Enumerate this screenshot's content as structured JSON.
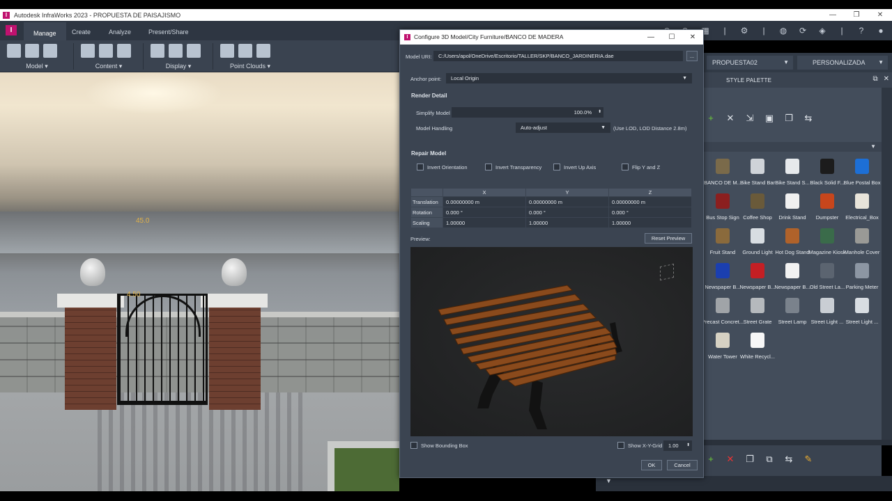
{
  "app": {
    "title": "Autodesk InfraWorks 2023 - PROPUESTA DE PAISAJISMO",
    "logo_letter": "I"
  },
  "ribbon": {
    "tabs": [
      {
        "label": "Manage",
        "active": true
      },
      {
        "label": "Create",
        "active": false
      },
      {
        "label": "Analyze",
        "active": false
      },
      {
        "label": "Present/Share",
        "active": false
      }
    ],
    "groups": [
      {
        "label": "Model"
      },
      {
        "label": "Content"
      },
      {
        "label": "Display"
      },
      {
        "label": "Point Clouds"
      }
    ]
  },
  "viewport": {
    "dim_top": "45.0",
    "dim_mid": "4.50"
  },
  "proposals": {
    "proposal_value": "PROPUESTA02",
    "view_value": "PERSONALIZADA"
  },
  "palette": {
    "title": "STYLE PALETTE",
    "items": [
      {
        "label": "BANCO DE M...",
        "color": "#7a6a4a"
      },
      {
        "label": "Bike Stand Bar",
        "color": "#cfd3d8"
      },
      {
        "label": "Bike Stand S...",
        "color": "#e6e9ec"
      },
      {
        "label": "Black Solid F...",
        "color": "#1c1c1c"
      },
      {
        "label": "Blue Postal Box",
        "color": "#1d6fd6"
      },
      {
        "label": "Bus Stop Sign",
        "color": "#8b1f1f"
      },
      {
        "label": "Coffee Shop",
        "color": "#6a5a3a"
      },
      {
        "label": "Drink Stand",
        "color": "#f0f0f0"
      },
      {
        "label": "Dumpster",
        "color": "#c7461c"
      },
      {
        "label": "Electrical_Box",
        "color": "#e8e4da"
      },
      {
        "label": "Fruit Stand",
        "color": "#8a6a3c"
      },
      {
        "label": "Ground Light",
        "color": "#d8dde2"
      },
      {
        "label": "Hot Dog Stand",
        "color": "#b0622a"
      },
      {
        "label": "Magazine Kiosk",
        "color": "#3a6b4a"
      },
      {
        "label": "Manhole Cover",
        "color": "#9a9a96"
      },
      {
        "label": "Newspaper B...",
        "color": "#1b3fb0"
      },
      {
        "label": "Newspaper B...",
        "color": "#c41f24"
      },
      {
        "label": "Newspaper B...",
        "color": "#f2f2f2"
      },
      {
        "label": "Old Street La...",
        "color": "#5b6470"
      },
      {
        "label": "Parking Meter",
        "color": "#8c96a3"
      },
      {
        "label": "Precast Concret...",
        "color": "#a0a4a8"
      },
      {
        "label": "Street Grate",
        "color": "#b5b9bd"
      },
      {
        "label": "Street Lamp",
        "color": "#7a828c"
      },
      {
        "label": "Street Light ...",
        "color": "#c9ced4"
      },
      {
        "label": "Street Light ...",
        "color": "#d8dde2"
      },
      {
        "label": "Water Tower",
        "color": "#d6d1c3"
      },
      {
        "label": "White Recycl...",
        "color": "#f7f7f7"
      }
    ]
  },
  "dialog": {
    "title": "Configure 3D Model/City Furniture/BANCO DE MADERA",
    "model_uri_label": "Model URI:",
    "model_uri_value": "C:/Users/apol/OneDrive/Escritorio/TALLER/SKP/BANCO_JARDINERIA.dae",
    "browse_label": "...",
    "anchor_label": "Anchor point:",
    "anchor_value": "Local Origin",
    "render_detail": "Render Detail",
    "simplify_label": "Simplify Model",
    "simplify_value": "100.0%",
    "handling_label": "Model Handling",
    "handling_value": "Auto-adjust",
    "handling_note": "(Use LOD, LOD Distance 2.8m)",
    "repair_model": "Repair Model",
    "checks": {
      "invert_orientation": "Invert Orientation",
      "invert_transparency": "Invert Transparency",
      "invert_up_axis": "Invert Up Axis",
      "flip_yz": "Flip Y and Z"
    },
    "table": {
      "cols": [
        "X",
        "Y",
        "Z"
      ],
      "rows": [
        {
          "name": "Translation",
          "x": "0.00000000 m",
          "y": "0.00000000 m",
          "z": "0.00000000 m"
        },
        {
          "name": "Rotation",
          "x": "0.000 °",
          "y": "0.000 °",
          "z": "0.000 °"
        },
        {
          "name": "Scaling",
          "x": "1.00000",
          "y": "1.00000",
          "z": "1.00000"
        }
      ]
    },
    "preview_label": "Preview:",
    "reset_preview": "Reset Preview",
    "show_bbox": "Show Bounding Box",
    "show_grid": "Show X-Y-Grid",
    "grid_value": "1.00",
    "ok": "OK",
    "cancel": "Cancel"
  }
}
